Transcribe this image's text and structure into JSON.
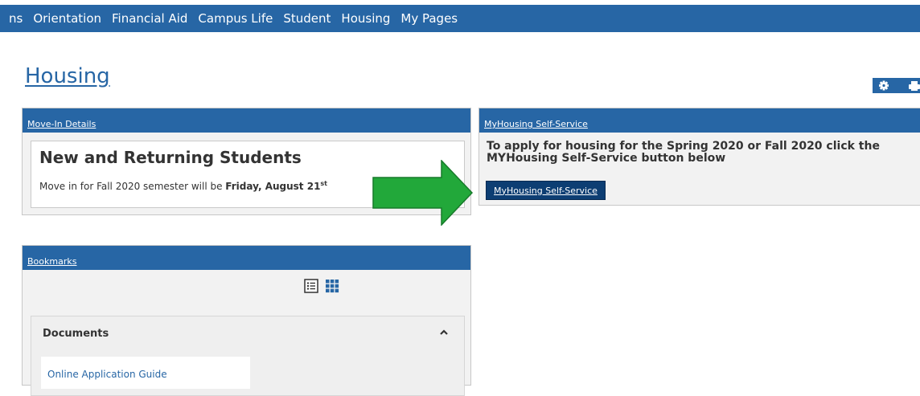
{
  "nav": {
    "items": [
      "ns",
      "Orientation",
      "Financial Aid",
      "Campus Life",
      "Student",
      "Housing",
      "My Pages"
    ]
  },
  "page": {
    "title": "Housing"
  },
  "move_in": {
    "title": "Move-In Details",
    "heading": "New and Returning Students",
    "text_prefix": "Move in for Fall 2020 semester will be ",
    "date": "Friday, August 21",
    "date_suffix": "st"
  },
  "myhousing": {
    "title": "MyHousing Self-Service",
    "heading": "To apply for housing for the Spring 2020 or Fall 2020 click the MYHousing Self-Service button below",
    "button_label": "MyHousing Self-Service"
  },
  "bookmarks": {
    "title": "Bookmarks",
    "documents_title": "Documents",
    "links": [
      "Online Application Guide"
    ]
  },
  "icons": {
    "tools": [
      "gear-icon",
      "print-icon"
    ],
    "view": [
      "list-view-icon",
      "grid-view-icon"
    ],
    "arrow": "arrow-right-icon",
    "collapse": "chevron-up-icon"
  },
  "colors": {
    "nav_blue": "#2766a5",
    "button_navy": "#0d3e73",
    "arrow_green": "#22a83a"
  }
}
